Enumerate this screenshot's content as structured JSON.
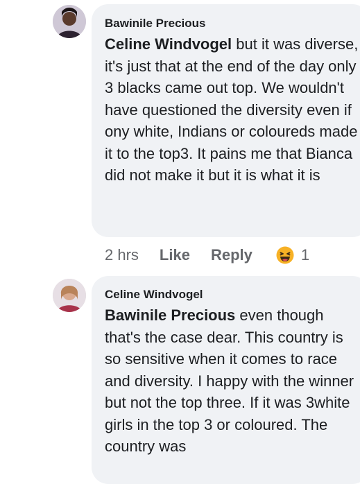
{
  "comments": [
    {
      "author": "Bawinile Precious",
      "mention": "Celine Windvogel",
      "text": " but it was diverse, it's just that at the end of the day only 3 blacks came out top. We wouldn't have questioned the diversity even if ony white, Indians or coloureds made it to the top3. It pains me that Bianca did not make it but it is what it is",
      "time": "2 hrs",
      "like_label": "Like",
      "reply_label": "Reply",
      "reaction": {
        "icon": "haha-reaction-icon",
        "count": "1"
      }
    },
    {
      "author": "Celine Windvogel",
      "mention": "Bawinile Precious",
      "text": " even though that's the case dear. This country is so sensitive when it comes to race and diversity. I happy with the winner but not the top three. If it was 3white girls in the top 3 or coloured. The country was"
    }
  ],
  "colors": {
    "bubble": "#f0f2f5",
    "text": "#1c1e21",
    "meta": "#65676b",
    "reaction": "#f7b125"
  }
}
